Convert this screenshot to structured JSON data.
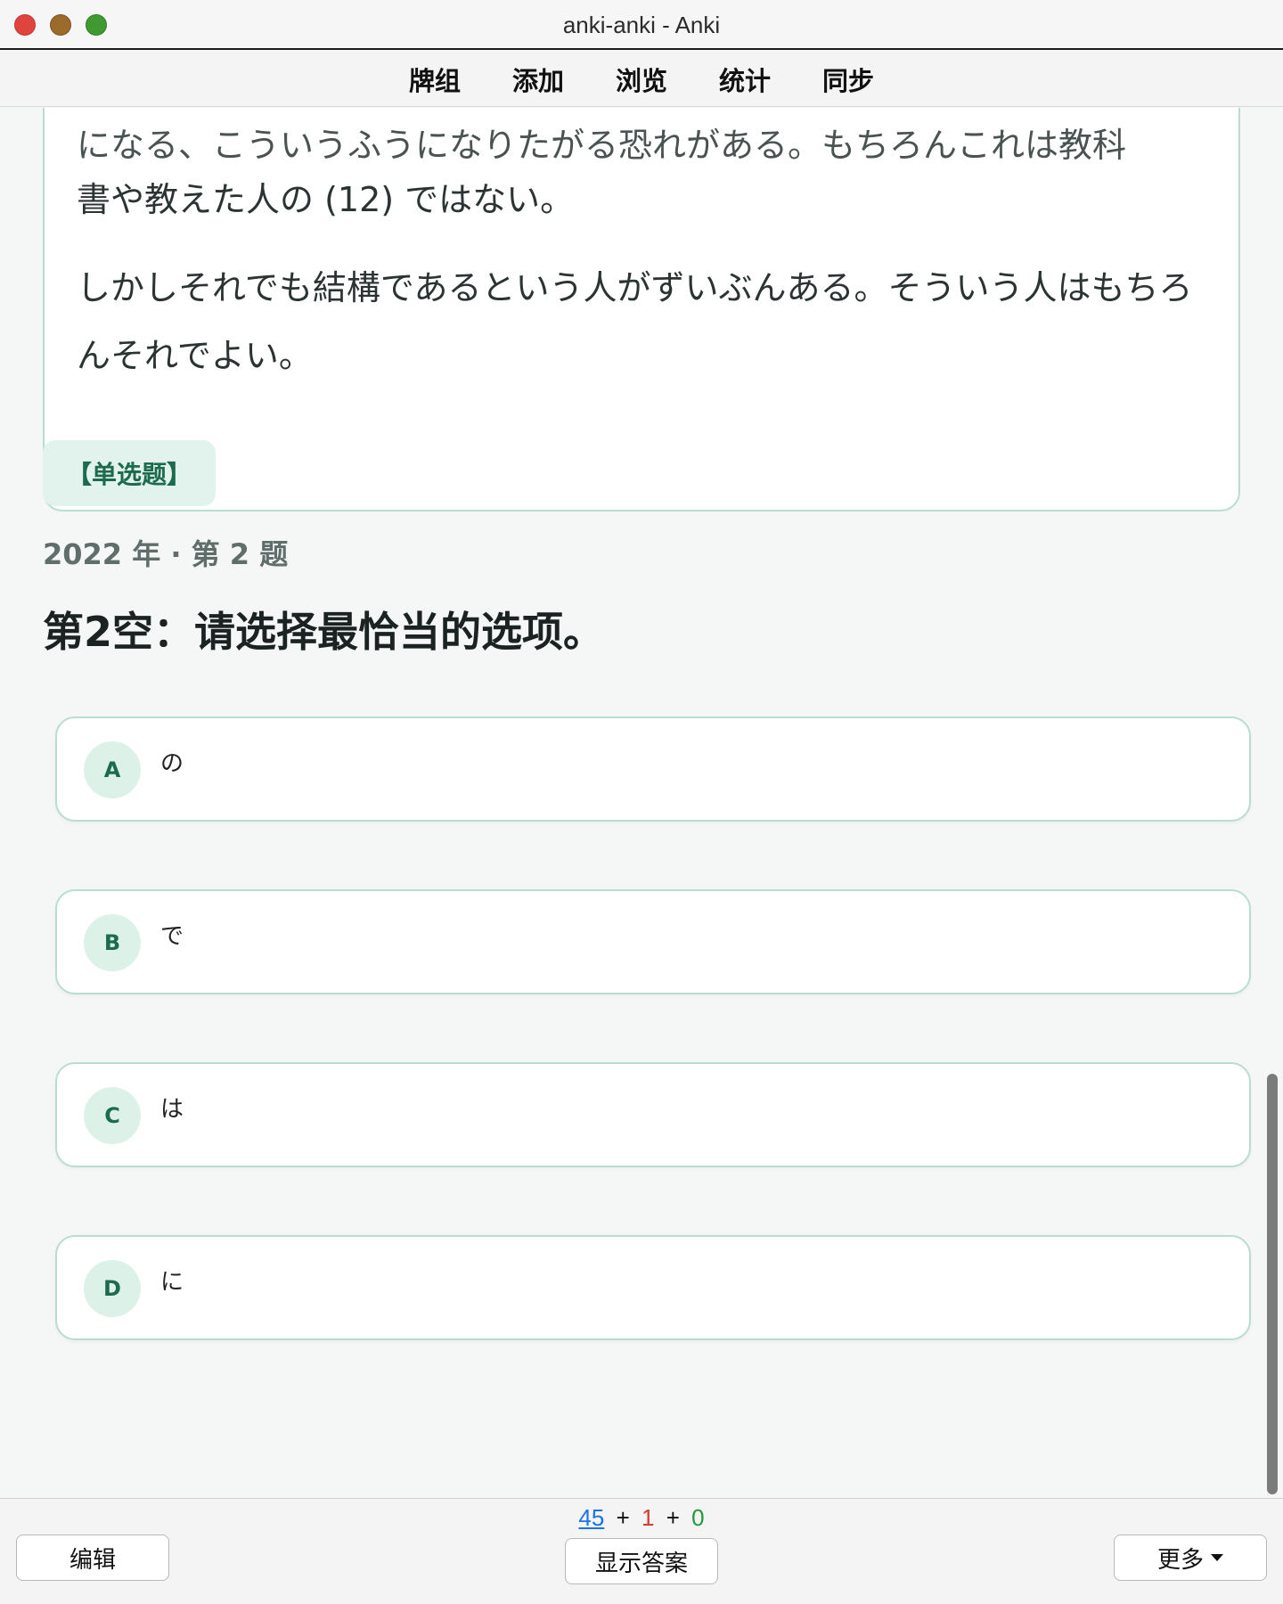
{
  "window": {
    "title": "anki-anki - Anki"
  },
  "menubar": {
    "items": [
      "牌组",
      "添加",
      "浏览",
      "统计",
      "同步"
    ]
  },
  "passage": {
    "cut_line": "になる、こういうふうになりたがる恐れがある。もちろんこれは教科",
    "line1": "書や教えた人の (12) ではない。",
    "para2": "しかしそれでも結構であるという人がずいぶんある。そういう人はもちろんそれでよい。"
  },
  "question": {
    "type_badge": "【单选题】",
    "meta": "2022 年 · 第 2 题",
    "title": "第2空：请选择最恰当的选项。"
  },
  "options": [
    {
      "letter": "A",
      "text": "の"
    },
    {
      "letter": "B",
      "text": "で"
    },
    {
      "letter": "C",
      "text": "は"
    },
    {
      "letter": "D",
      "text": "に"
    }
  ],
  "bottombar": {
    "counts": {
      "new": "45",
      "learn": "1",
      "review": "0",
      "plus": "+"
    },
    "edit_label": "编辑",
    "show_answer_label": "显示答案",
    "more_label": "更多"
  },
  "colors": {
    "accent": "#1d6b4e",
    "card_border": "#b9ddd0",
    "badge_bg": "#e1f3ec",
    "count_new": "#1a73e8",
    "count_learn": "#d63a2c",
    "count_review": "#1f9b3b"
  },
  "icons": {
    "more_caret": "caret-down-icon"
  }
}
